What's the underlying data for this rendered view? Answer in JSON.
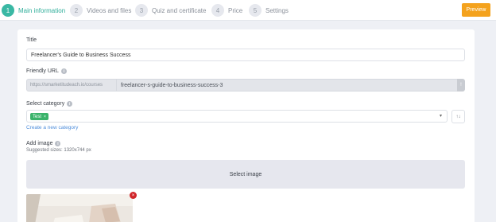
{
  "steps": [
    {
      "num": "1",
      "label": "Main information",
      "active": true
    },
    {
      "num": "2",
      "label": "Videos and files",
      "active": false
    },
    {
      "num": "3",
      "label": "Quiz and certificate",
      "active": false
    },
    {
      "num": "4",
      "label": "Price",
      "active": false
    },
    {
      "num": "5",
      "label": "Settings",
      "active": false
    }
  ],
  "header": {
    "preview_label": "Preview"
  },
  "form": {
    "title_label": "Title",
    "title_value": "Freelancer's Guide to Business Success",
    "url_label": "Friendly URL",
    "url_prefix": "https://smarketitudeach.io/courses",
    "url_slug": "freelancer-s-guide-to-business-success-3",
    "url_handle_icon": "!",
    "category_label": "Select category",
    "category_tag": "Test",
    "category_tag_remove": "×",
    "category_chevron": "▾",
    "category_sort_icon": "↑↓",
    "create_category_link": "Create a new category",
    "image_label": "Add image",
    "image_suggested": "Suggested sizes: 1320x744 px",
    "select_image_label": "Select image",
    "thumbnail_remove": "×"
  },
  "icons": {
    "info": "i"
  },
  "colors": {
    "accent_teal": "#3ab8a4",
    "preview_orange": "#f4a21d",
    "tag_green": "#3bb36b",
    "link_blue": "#4f8edb",
    "delete_red": "#d1262b"
  }
}
